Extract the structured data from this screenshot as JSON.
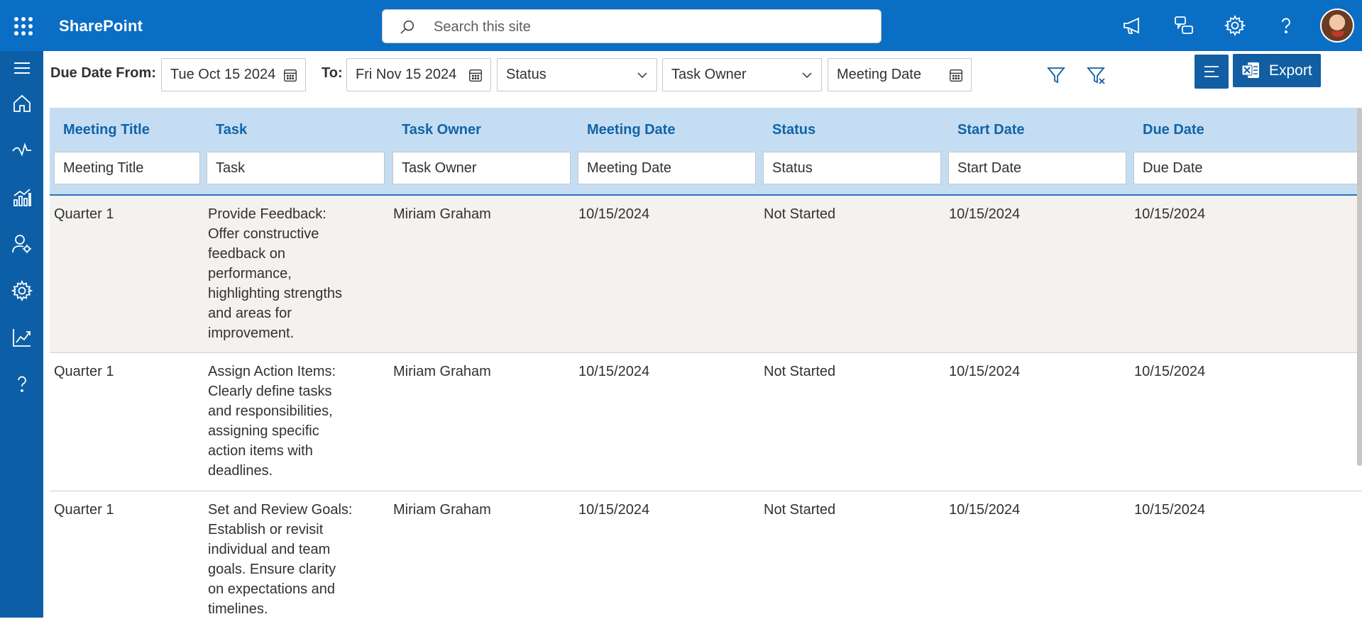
{
  "app": {
    "brand": "SharePoint"
  },
  "search": {
    "placeholder": "Search this site"
  },
  "topbar_icons": [
    "megaphone-icon",
    "feedback-icon",
    "settings-icon",
    "help-icon"
  ],
  "leftrail_icons": [
    "hamburger-icon",
    "home-icon",
    "pulse-icon",
    "analytics-icon",
    "user-settings-icon",
    "settings-icon",
    "trend-icon",
    "help-icon"
  ],
  "filters": {
    "due_from_label": "Due Date From:",
    "due_from_value": "Tue Oct 15 2024",
    "to_label": "To:",
    "to_value": "Fri Nov 15 2024",
    "status_placeholder": "Status",
    "owner_placeholder": "Task Owner",
    "meeting_date_placeholder": "Meeting Date"
  },
  "toolbar": {
    "export_label": "Export"
  },
  "columns": [
    {
      "header": "Meeting Title",
      "filter_placeholder": "Meeting Title"
    },
    {
      "header": "Task",
      "filter_placeholder": "Task"
    },
    {
      "header": "Task Owner",
      "filter_placeholder": "Task Owner"
    },
    {
      "header": "Meeting Date",
      "filter_placeholder": "Meeting Date"
    },
    {
      "header": "Status",
      "filter_placeholder": "Status"
    },
    {
      "header": "Start Date",
      "filter_placeholder": "Start Date"
    },
    {
      "header": "Due Date",
      "filter_placeholder": "Due Date"
    }
  ],
  "rows": [
    {
      "meeting_title": "Quarter 1",
      "task_lines": [
        "Provide Feedback:",
        "Offer constructive",
        "feedback on",
        "performance,",
        "highlighting strengths",
        "and areas for",
        "improvement."
      ],
      "owner": "Miriam Graham",
      "meeting_date": "10/15/2024",
      "status": "Not Started",
      "start_date": "10/15/2024",
      "due_date": "10/15/2024"
    },
    {
      "meeting_title": "Quarter 1",
      "task_lines": [
        "Assign Action Items:",
        "Clearly define tasks",
        "and responsibilities,",
        "assigning specific",
        "action items with",
        "deadlines."
      ],
      "owner": "Miriam Graham",
      "meeting_date": "10/15/2024",
      "status": "Not Started",
      "start_date": "10/15/2024",
      "due_date": "10/15/2024"
    },
    {
      "meeting_title": "Quarter 1",
      "task_lines": [
        "Set and Review Goals:",
        "Establish or revisit",
        "individual and team",
        "goals. Ensure clarity",
        "on expectations and",
        "timelines."
      ],
      "owner": "Miriam Graham",
      "meeting_date": "10/15/2024",
      "status": "Not Started",
      "start_date": "10/15/2024",
      "due_date": "10/15/2024"
    }
  ],
  "colors": {
    "suite_bar": "#0a6ec4",
    "left_rail": "#0c5fa7",
    "header_bg": "#c4ddf3",
    "header_text": "#1163a8"
  }
}
